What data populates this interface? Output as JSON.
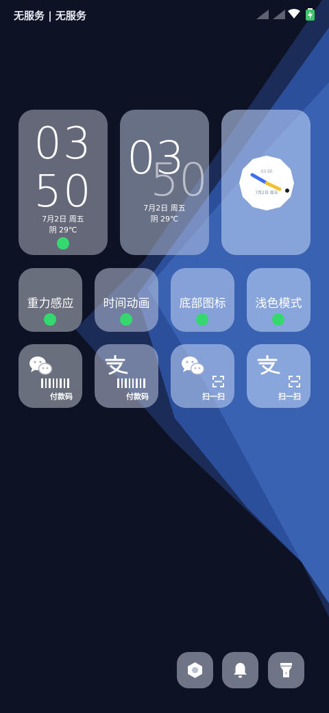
{
  "status_bar": {
    "carrier": "无服务 | 无服务",
    "icons": [
      "signal-icon",
      "signal-icon",
      "wifi-icon",
      "battery-charging-icon"
    ]
  },
  "clock_widgets": {
    "digital": {
      "hour": "03",
      "minute": "50",
      "date": "7月2日 周五",
      "weather": "阴 29℃",
      "toggle_color": "#35d86f"
    },
    "overlap": {
      "hour": "03",
      "minute": "50",
      "date": "7月2日 周五",
      "weather": "阴 29℃"
    },
    "analog": {
      "time": "03 50",
      "date": "7月2日 周五",
      "hour_hand_color": "#3d6df2",
      "minute_hand_color": "#f2c035"
    }
  },
  "features": [
    {
      "label": "重力感应",
      "enabled": true
    },
    {
      "label": "时间动画",
      "enabled": true
    },
    {
      "label": "底部图标",
      "enabled": true
    },
    {
      "label": "浅色模式",
      "enabled": true
    }
  ],
  "shortcuts": [
    {
      "app_icon": "wechat-icon",
      "action_icon": "barcode-icon",
      "label": "付款码"
    },
    {
      "app_icon": "alipay-icon",
      "action_icon": "barcode-icon",
      "label": "付款码"
    },
    {
      "app_icon": "wechat-icon",
      "action_icon": "scan-icon",
      "label": "扫一扫"
    },
    {
      "app_icon": "alipay-icon",
      "action_icon": "scan-icon",
      "label": "扫一扫"
    }
  ],
  "dock": [
    {
      "icon": "settings-hexagon-icon"
    },
    {
      "icon": "bell-icon"
    },
    {
      "icon": "flashlight-icon"
    }
  ],
  "colors": {
    "background": "#0d1225",
    "accent_blue": "#3a62b0",
    "toggle_on": "#35d86f"
  }
}
